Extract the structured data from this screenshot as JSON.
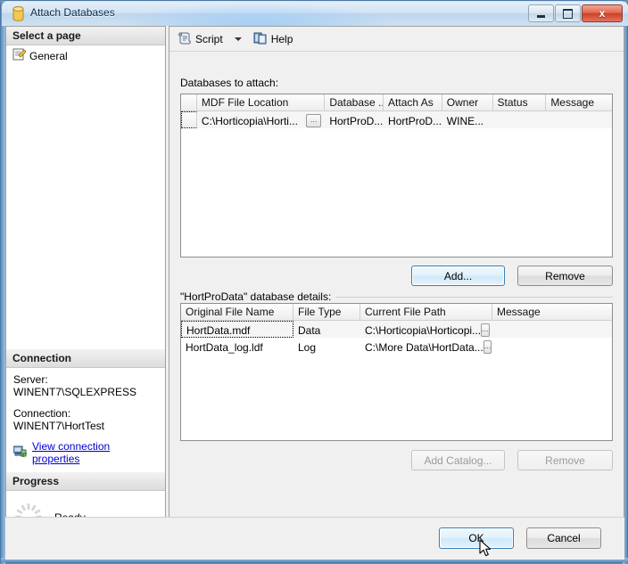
{
  "window": {
    "title": "Attach Databases",
    "icon": "database-icon",
    "buttons": {
      "minimize": "minimize-icon",
      "maximize": "maximize-icon",
      "close": "x"
    }
  },
  "sidebar": {
    "select_page_header": "Select a page",
    "pages": [
      {
        "label": "General",
        "icon": "page-icon",
        "selected": true
      }
    ],
    "connection_header": "Connection",
    "server_label": "Server:",
    "server_value": "WINENT7\\SQLEXPRESS",
    "connection_label": "Connection:",
    "connection_value": "WINENT7\\HortTest",
    "view_connection_link": "View connection properties",
    "view_connection_icon": "server-connection-icon",
    "progress_header": "Progress",
    "progress_status": "Ready",
    "progress_icon": "spinner-icon"
  },
  "toolbar": {
    "script_label": "Script",
    "script_icon": "script-scroll-icon",
    "dropdown_icon": "chevron-down-icon",
    "help_label": "Help",
    "help_icon": "help-book-icon"
  },
  "attach_grid": {
    "label": "Databases to attach:",
    "columns": [
      "MDF File Location",
      "Database ...",
      "Attach As",
      "Owner",
      "Status",
      "Message"
    ],
    "rows": [
      {
        "mdf_file_location": "C:\\Horticopia\\Horti...",
        "browse_label": "...",
        "database_name": "HortProD...",
        "attach_as": "HortProD...",
        "owner": "WINE...",
        "status": "",
        "message": "",
        "focused": true
      }
    ],
    "add_button": "Add...",
    "remove_button": "Remove"
  },
  "details_grid": {
    "label": "\"HortProData\" database details:",
    "columns": [
      "Original File Name",
      "File Type",
      "Current File Path",
      "Message"
    ],
    "rows": [
      {
        "original_file_name": "HortData.mdf",
        "file_type": "Data",
        "current_file_path": "C:\\Horticopia\\Horticopi...",
        "browse_label": "...",
        "message": "",
        "focused": true
      },
      {
        "original_file_name": "HortData_log.ldf",
        "file_type": "Log",
        "current_file_path": "C:\\More Data\\HortData...",
        "browse_label": "...",
        "message": "",
        "focused": false
      }
    ],
    "add_catalog_button": "Add Catalog...",
    "remove_button": "Remove"
  },
  "footer": {
    "ok_button": "OK",
    "cancel_button": "Cancel"
  },
  "colors": {
    "accent": "#3c7fb1",
    "link": "#0000d0",
    "title_text": "#0c2a49",
    "close_button": "#cb4226"
  }
}
